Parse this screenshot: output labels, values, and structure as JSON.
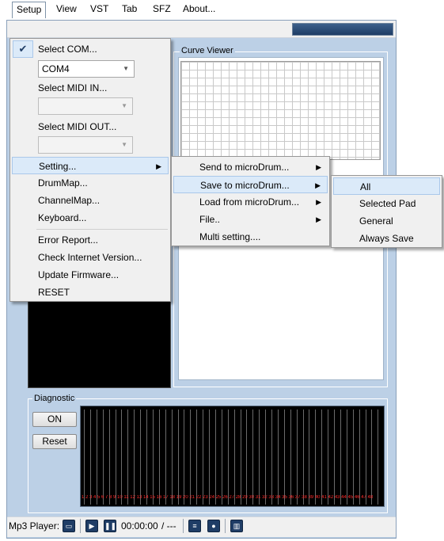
{
  "menubar": {
    "items": [
      "Setup",
      "View",
      "VST",
      "Tab",
      "SFZ",
      "About..."
    ]
  },
  "setup_menu": {
    "select_com": "Select COM...",
    "com_value": "COM4",
    "select_midi_in": "Select MIDI IN...",
    "select_midi_out": "Select MIDI OUT...",
    "setting": "Setting...",
    "drummap": "DrumMap...",
    "channelmap": "ChannelMap...",
    "keyboard": "Keyboard...",
    "error_report": "Error Report...",
    "check_internet": "Check Internet Version...",
    "update_firmware": "Update Firmware...",
    "reset": "RESET"
  },
  "setting_submenu": {
    "send": "Send to microDrum...",
    "save": "Save to microDrum...",
    "load": "Load from microDrum...",
    "file": "File..",
    "multi": "Multi setting...."
  },
  "save_submenu": {
    "all": "All",
    "selected_pad": "Selected Pad",
    "general": "General",
    "always_save": "Always Save"
  },
  "curve_viewer": {
    "title": "Curve Viewer"
  },
  "diagnostic": {
    "title": "Diagnostic",
    "on_label": "ON",
    "reset_label": "Reset"
  },
  "statusbar": {
    "label": "Mp3 Player:",
    "time": "00:00:00",
    "total": "/ ---"
  },
  "colors": {
    "window_bg": "#bcd0e6",
    "menu_highlight": "#dbeaf9",
    "diag_label": "#ff2a2a"
  }
}
